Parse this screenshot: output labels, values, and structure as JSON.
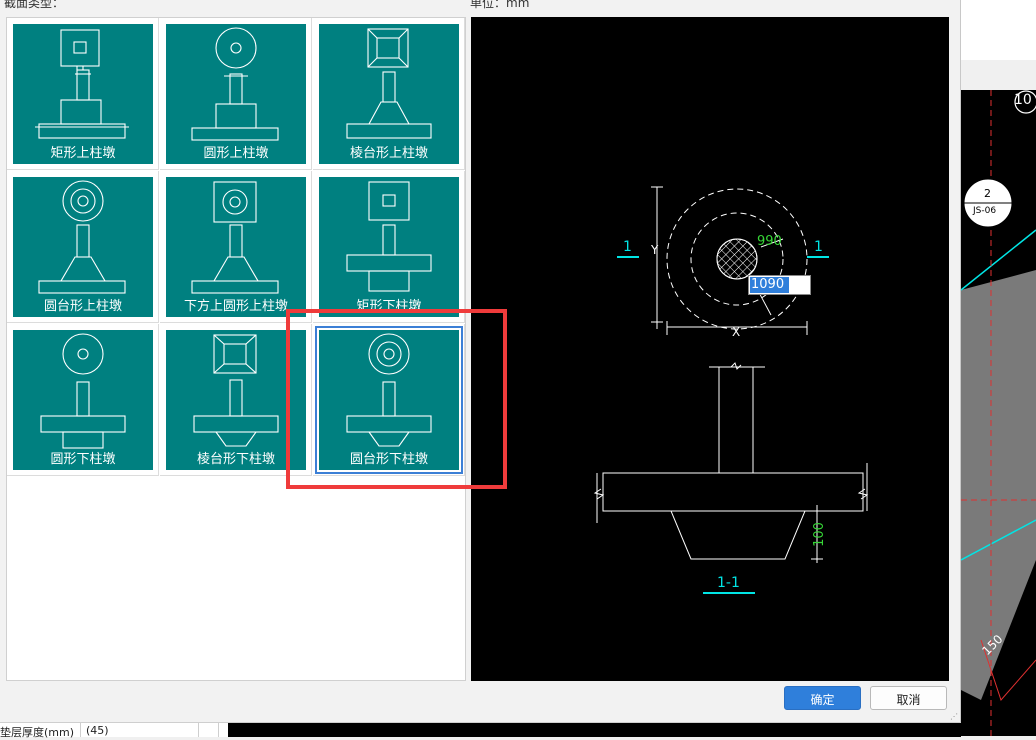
{
  "dialog": {
    "section_type_label": "截面类型：",
    "unit_label": "单位：mm",
    "tiles": [
      {
        "label": "矩形上柱墩"
      },
      {
        "label": "圆形上柱墩"
      },
      {
        "label": "棱台形上柱墩"
      },
      {
        "label": "圆台形上柱墩"
      },
      {
        "label": "下方上圆形上柱墩"
      },
      {
        "label": "矩形下柱墩"
      },
      {
        "label": "圆形下柱墩"
      },
      {
        "label": "棱台形下柱墩"
      },
      {
        "label": "圆台形下柱墩",
        "selected": true
      }
    ],
    "buttons": {
      "ok": "确定",
      "cancel": "取消"
    }
  },
  "preview": {
    "section_mark_left": "1",
    "section_mark_right": "1",
    "dim_y": "Y",
    "dim_x": "X",
    "inner_dim": "990",
    "outer_dim_input": "1090",
    "height_dim": "100",
    "section_title": "1-1"
  },
  "background_cad": {
    "axis_label": "10",
    "tag_number": "2",
    "tag_code": "JS-06",
    "dim_label": "150"
  },
  "bottom_panel": {
    "property_label": "垫层厚度(mm)",
    "property_value": "(45)"
  },
  "colors": {
    "tile_bg": "#008080",
    "highlight": "#ef3b3b",
    "selection": "#3c7fd6",
    "cad_cyan": "#00e5e5",
    "cad_green": "#36d636",
    "ok_button": "#2f7fdb"
  }
}
